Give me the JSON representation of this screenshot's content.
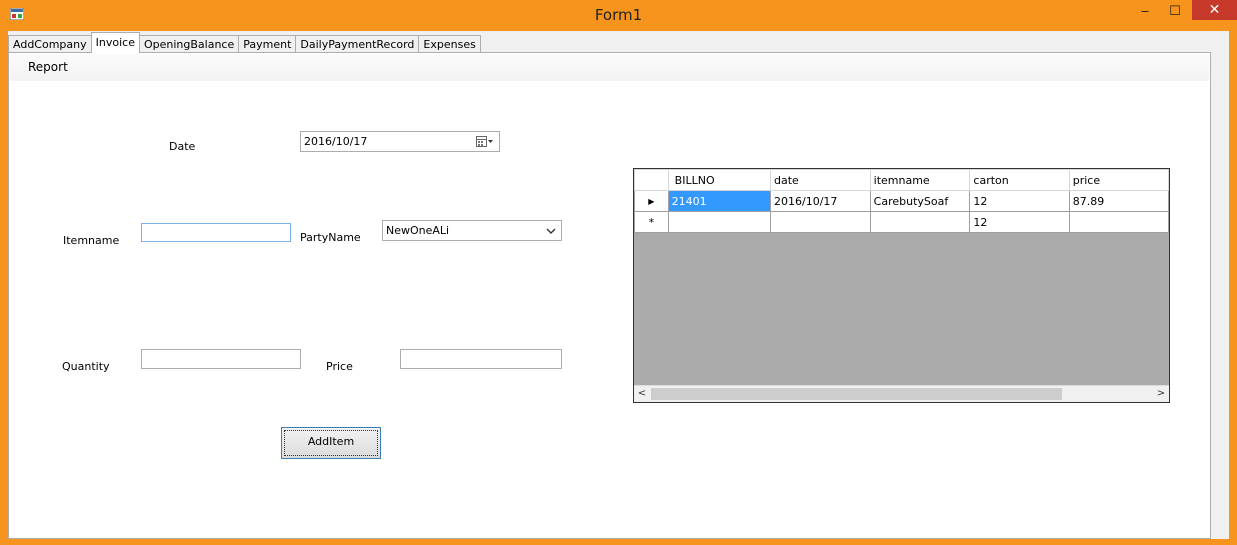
{
  "window": {
    "title": "Form1",
    "minimize_glyph": "‒",
    "maximize_glyph": "☐",
    "close_glyph": "✕",
    "accent_color": "#f7941d"
  },
  "tabs": [
    {
      "label": "AddCompany"
    },
    {
      "label": "Invoice",
      "active": true
    },
    {
      "label": "OpeningBalance"
    },
    {
      "label": "Payment"
    },
    {
      "label": "DailyPaymentRecord"
    },
    {
      "label": "Expenses"
    }
  ],
  "menu": {
    "report_label": "Report"
  },
  "form": {
    "date_label": "Date",
    "date_value": "2016/10/17",
    "itemname_label": "Itemname",
    "itemname_value": "",
    "partyname_label": "PartyName",
    "partyname_value": "NewOneALi",
    "quantity_label": "Quantity",
    "quantity_value": "",
    "price_label": "Price",
    "price_value": "",
    "additem_label": "AddItem"
  },
  "grid": {
    "columns": [
      "BILLNO",
      "date",
      "itemname",
      "carton",
      "price"
    ],
    "rows": [
      {
        "indicator": "▶",
        "cells": [
          "21401",
          "2016/10/17",
          "CarebutySoaf",
          "12",
          "87.89"
        ]
      },
      {
        "indicator": "*",
        "cells": [
          "",
          "",
          "",
          "12",
          ""
        ]
      }
    ],
    "scroll_left": "<",
    "scroll_right": ">"
  }
}
